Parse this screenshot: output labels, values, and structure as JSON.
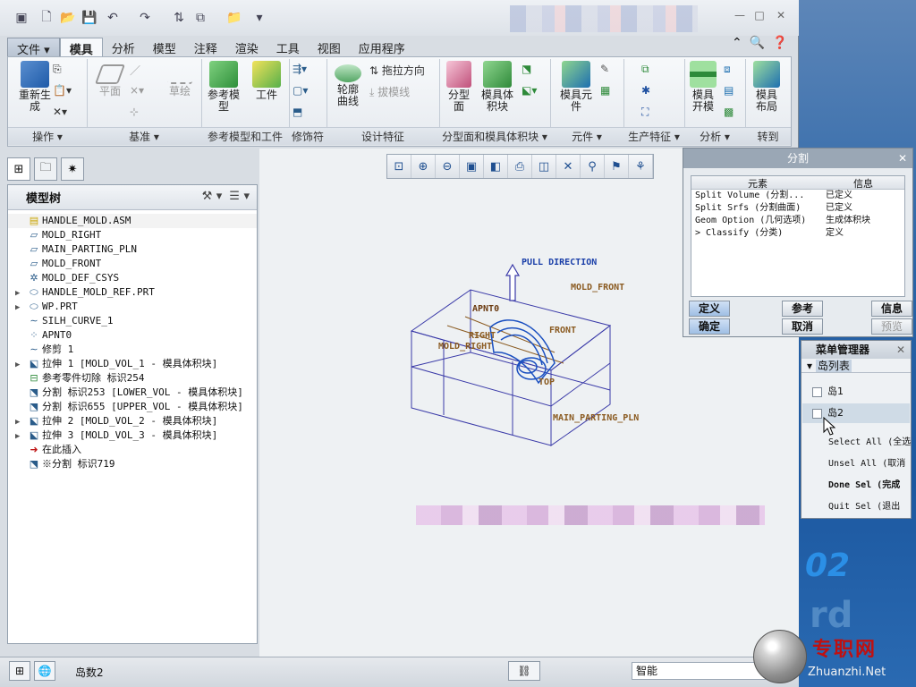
{
  "title_bar": {
    "quick_access": [
      "new-icon",
      "open-icon",
      "save-icon",
      "undo-icon",
      "redo-icon",
      "regenerate-icon",
      "windows-icon",
      "folder-icon",
      "customize-icon"
    ],
    "window_controls": [
      "—",
      "□",
      "✕"
    ]
  },
  "ribbon": {
    "tabs": [
      "文件",
      "模具",
      "分析",
      "模型",
      "注释",
      "渲染",
      "工具",
      "视图",
      "应用程序"
    ],
    "active_tab": "模具",
    "buttons": {
      "regen": "重新生\n成",
      "plane": "平面",
      "sketch": "草绘",
      "ref_model": "参考模\n型",
      "workpiece": "工件",
      "draft_direction": "拖拉方向",
      "draft_line": "拔模线",
      "silhouette": "轮廓\n曲线",
      "parting_surface": "分型\n面",
      "mold_volume": "模具体\n积块",
      "mold_component": "模具元\n件",
      "mold_open": "模具\n开模",
      "mold_layout": "模具\n布局"
    },
    "groups": [
      "操作 ▾",
      "基准 ▾",
      "参考模型和工件",
      "修饰符",
      "设计特征",
      "分型面和模具体积块 ▾",
      "元件 ▾",
      "生产特征 ▾",
      "分析 ▾",
      "转到"
    ]
  },
  "model_tree": {
    "title": "模型树",
    "items": [
      {
        "expand": "",
        "icon": "assembly-icon",
        "text": "HANDLE_MOLD.ASM"
      },
      {
        "expand": "",
        "icon": "datum-plane-icon",
        "text": "MOLD_RIGHT"
      },
      {
        "expand": "",
        "icon": "datum-plane-icon",
        "text": "MAIN_PARTING_PLN"
      },
      {
        "expand": "",
        "icon": "datum-plane-icon",
        "text": "MOLD_FRONT"
      },
      {
        "expand": "",
        "icon": "csys-icon",
        "text": "MOLD_DEF_CSYS"
      },
      {
        "expand": "▶",
        "icon": "part-icon",
        "text": "HANDLE_MOLD_REF.PRT"
      },
      {
        "expand": "▶",
        "icon": "part-icon",
        "text": "WP.PRT"
      },
      {
        "expand": "",
        "icon": "curve-icon",
        "text": "SILH_CURVE_1"
      },
      {
        "expand": "",
        "icon": "point-icon",
        "text": "APNT0"
      },
      {
        "expand": "",
        "icon": "curve-icon",
        "text": "修剪 1"
      },
      {
        "expand": "▶",
        "icon": "extrude-icon",
        "text": "拉伸 1 [MOLD_VOL_1 - 模具体积块]"
      },
      {
        "expand": "",
        "icon": "cut-icon",
        "text": "参考零件切除 标识254"
      },
      {
        "expand": "",
        "icon": "split-icon",
        "text": "分割 标识253 [LOWER_VOL - 模具体积块]"
      },
      {
        "expand": "",
        "icon": "split-icon",
        "text": "分割 标识655 [UPPER_VOL - 模具体积块]"
      },
      {
        "expand": "▶",
        "icon": "extrude-icon",
        "text": "拉伸 2 [MOLD_VOL_2 - 模具体积块]"
      },
      {
        "expand": "▶",
        "icon": "extrude-icon",
        "text": "拉伸 3 [MOLD_VOL_3 - 模具体积块]"
      },
      {
        "expand": "",
        "icon": "insert-here-icon",
        "text": "在此插入"
      },
      {
        "expand": "",
        "icon": "split-icon",
        "text": "※分割 标识719"
      }
    ]
  },
  "graphics": {
    "labels": {
      "pull_direction": "PULL DIRECTION",
      "mold_front": "MOLD_FRONT",
      "apnt": "APNT0",
      "right": "RIGHT",
      "mold_right": "MOLD_RIGHT",
      "front": "FRONT",
      "top": "TOP",
      "main_parting": "MAIN_PARTING_PLN"
    },
    "colors": {
      "mold_box": "#3a3aa8",
      "datum": "#8a5a20",
      "part": "#1a4fc0"
    }
  },
  "split_dialog": {
    "title": "分割",
    "col_element": "元素",
    "col_info": "信息",
    "rows": [
      {
        "element": " Split Volume (分割...",
        "info": "已定义"
      },
      {
        "element": " Split Srfs (分割曲面)",
        "info": "已定义"
      },
      {
        "element": " Geom Option (几何选项)",
        "info": "生成体积块"
      },
      {
        "element": "> Classify (分类)",
        "info": "定义"
      }
    ],
    "buttons": {
      "define": "定义",
      "ref": "参考",
      "info": "信息",
      "ok": "确定",
      "cancel": "取消",
      "preview": "预览"
    }
  },
  "menu_manager": {
    "title": "菜单管理器",
    "submenu": "岛列表",
    "islands": [
      "岛1",
      "岛2"
    ],
    "commands": [
      "Select All (全选)",
      "Unsel All (取消",
      "Done Sel (完成",
      "Quit Sel (退出"
    ]
  },
  "status_bar": {
    "message": "岛数2",
    "filter": "智能"
  },
  "watermark": {
    "cn": "专职网",
    "en": "Zhuanzhi.Net"
  }
}
